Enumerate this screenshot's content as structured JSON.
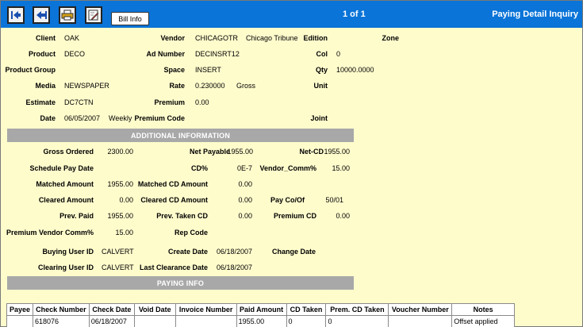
{
  "toolbar": {
    "bill_info_label": "Bill Info",
    "pager": "1 of 1",
    "title": "Paying Detail Inquiry",
    "color": "#0a74d8"
  },
  "header": {
    "client_label": "Client",
    "client_value": "OAK",
    "vendor_label": "Vendor",
    "vendor_code": "CHICAGOTR",
    "vendor_name": "Chicago Tribune",
    "edition_label": "Edition",
    "zone_label": "Zone",
    "product_label": "Product",
    "product_value": "DECO",
    "ad_number_label": "Ad Number",
    "ad_number_value": "DECINSRT12",
    "col_label": "Col",
    "col_value": "0",
    "product_group_label": "Product Group",
    "space_label": "Space",
    "space_value": "INSERT",
    "qty_label": "Qty",
    "qty_value": "10000.0000",
    "media_label": "Media",
    "media_value": "NEWSPAPER",
    "rate_label": "Rate",
    "rate_value": "0.230000",
    "rate_type": "Gross",
    "unit_label": "Unit",
    "estimate_label": "Estimate",
    "estimate_value": "DC7CTN",
    "premium_label": "Premium",
    "premium_value": "0.00",
    "date_label": "Date",
    "date_value": "06/05/2007",
    "date_freq": "Weekly",
    "premium_code_label": "Premium Code",
    "joint_label": "Joint"
  },
  "additional": {
    "section_title": "ADDITIONAL INFORMATION",
    "gross_ordered_label": "Gross Ordered",
    "gross_ordered_value": "2300.00",
    "net_payable_label": "Net Payable",
    "net_payable_value": "1955.00",
    "net_cd_label": "Net-CD",
    "net_cd_value": "1955.00",
    "schedule_pay_date_label": "Schedule Pay Date",
    "cd_pct_label": "CD%",
    "cd_pct_value": "0E-7",
    "vendor_comm_label": "Vendor_Comm%",
    "vendor_comm_value": "15.00",
    "matched_amount_label": "Matched Amount",
    "matched_amount_value": "1955.00",
    "matched_cd_amount_label": "Matched CD Amount",
    "matched_cd_amount_value": "0.00",
    "cleared_amount_label": "Cleared Amount",
    "cleared_amount_value": "0.00",
    "cleared_cd_amount_label": "Cleared CD Amount",
    "cleared_cd_amount_value": "0.00",
    "pay_co_of_label": "Pay Co/Of",
    "pay_co_of_value": "50/01",
    "prev_paid_label": "Prev. Paid",
    "prev_paid_value": "1955.00",
    "prev_taken_cd_label": "Prev. Taken CD",
    "prev_taken_cd_value": "0.00",
    "premium_cd_label": "Premium CD",
    "premium_cd_value": "0.00",
    "premium_vendor_comm_label": "Premium Vendor Comm%",
    "premium_vendor_comm_value": "15.00",
    "rep_code_label": "Rep Code",
    "buying_user_id_label": "Buying User ID",
    "buying_user_id_value": "CALVERT",
    "create_date_label": "Create Date",
    "create_date_value": "06/18/2007",
    "change_date_label": "Change Date",
    "clearing_user_id_label": "Clearing User ID",
    "clearing_user_id_value": "CALVERT",
    "last_clearance_date_label": "Last Clearance Date",
    "last_clearance_date_value": "06/18/2007"
  },
  "paying": {
    "section_title": "PAYING INFO",
    "columns": [
      "Payee",
      "Check Number",
      "Check Date",
      "Void Date",
      "Invoice Number",
      "Paid Amount",
      "CD Taken",
      "Prem. CD Taken",
      "Voucher Number",
      "Notes"
    ],
    "rows": [
      [
        "",
        "618076",
        "06/18/2007",
        "",
        "",
        "1955.00",
        "0",
        "0",
        "",
        "Offset applied"
      ]
    ]
  }
}
